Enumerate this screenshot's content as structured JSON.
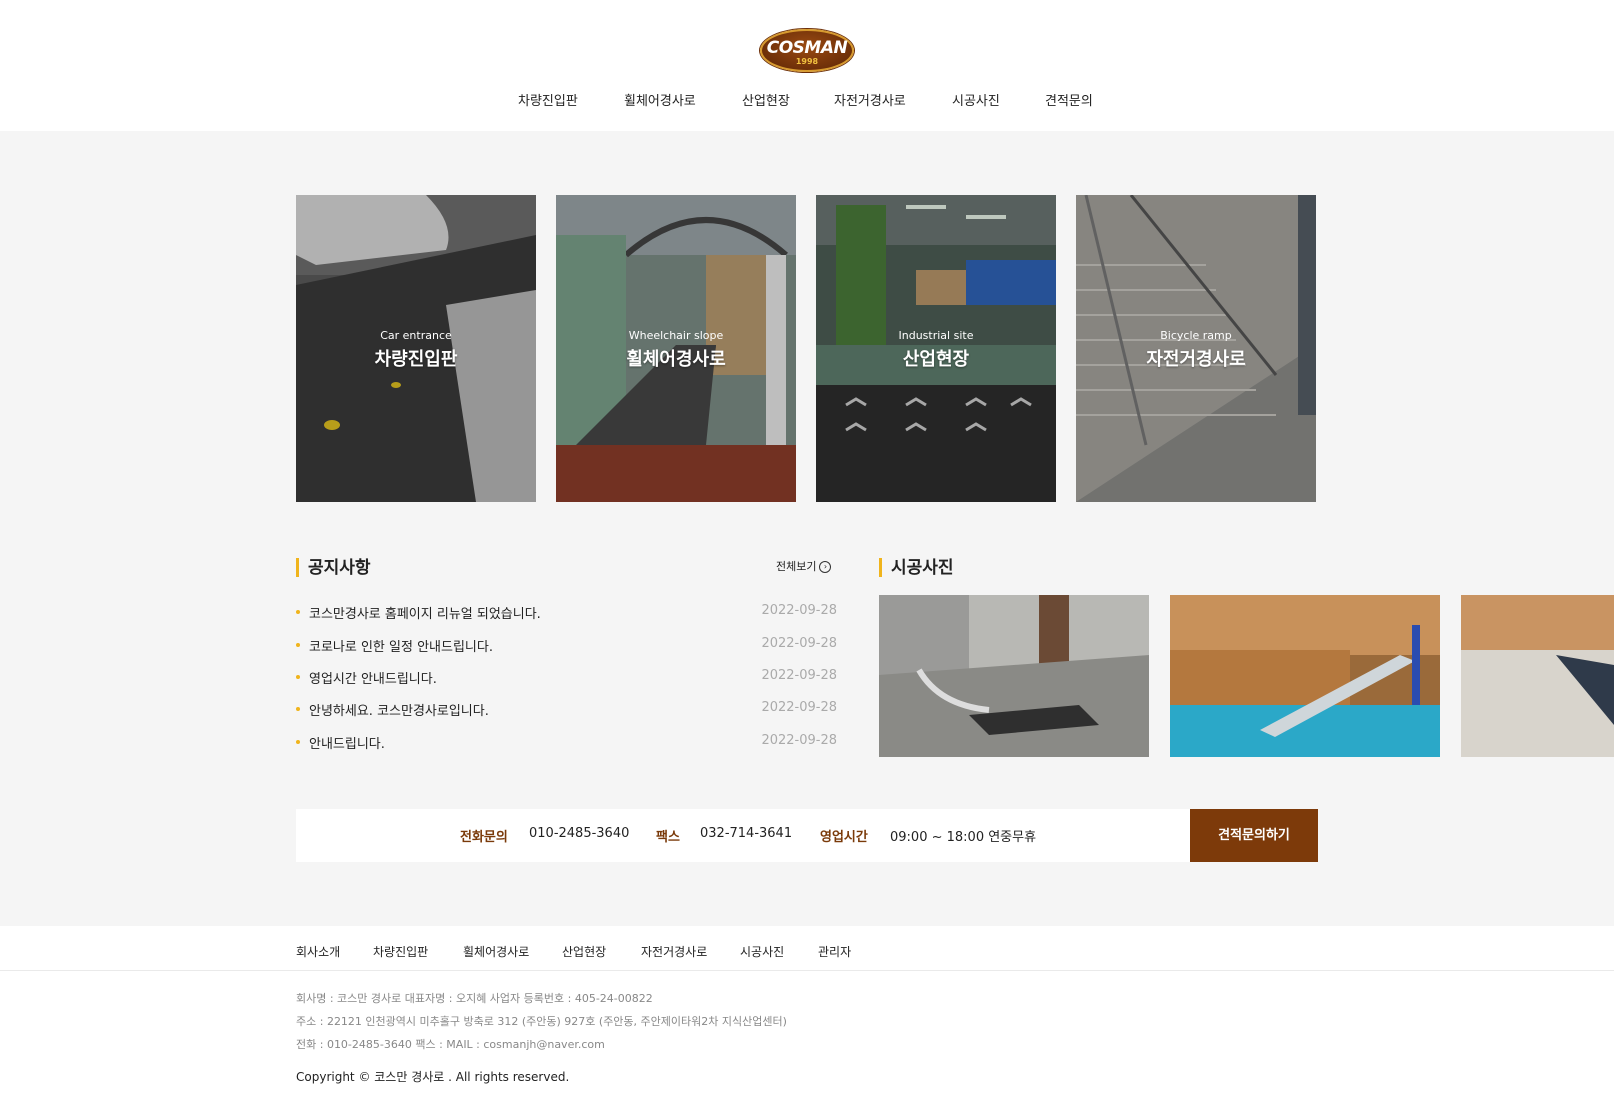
{
  "header": {
    "logo_text": "COSMAN",
    "logo_year": "1998",
    "nav": [
      "차량진입판",
      "휠체어경사로",
      "산업현장",
      "자전거경사로",
      "시공사진",
      "견적문의"
    ]
  },
  "cards": [
    {
      "en": "Car entrance",
      "ko": "차량진입판"
    },
    {
      "en": "Wheelchair slope",
      "ko": "휠체어경사로"
    },
    {
      "en": "Industrial site",
      "ko": "산업현장"
    },
    {
      "en": "Bicycle ramp",
      "ko": "자전거경사로"
    }
  ],
  "notice": {
    "title": "공지사항",
    "more_label": "전체보기",
    "items": [
      {
        "title": "코스만경사로 홈페이지 리뉴얼 되었습니다.",
        "date": "2022-09-28"
      },
      {
        "title": "코로나로 인한 일정 안내드립니다.",
        "date": "2022-09-28"
      },
      {
        "title": "영업시간 안내드립니다.",
        "date": "2022-09-28"
      },
      {
        "title": "안녕하세요. 코스만경사로입니다.",
        "date": "2022-09-28"
      },
      {
        "title": "안내드립니다.",
        "date": "2022-09-28"
      }
    ]
  },
  "gallery": {
    "title": "시공사진"
  },
  "contact": {
    "phone_label": "전화문의",
    "phone_value": "010-2485-3640",
    "fax_label": "팩스",
    "fax_value": "032-714-3641",
    "hours_label": "영업시간",
    "hours_value": "09:00 ~ 18:00 연중무휴",
    "button_label": "견적문의하기"
  },
  "footer": {
    "nav": [
      "회사소개",
      "차량진입판",
      "휠체어경사로",
      "산업현장",
      "자전거경사로",
      "시공사진",
      "관리자"
    ],
    "info_line1": "회사명 : 코스만 경사로    대표자명 : 오지혜     사업자 등록번호 : 405-24-00822",
    "info_line2": "주소 : 22121 인천광역시 미추홀구 방축로 312 (주안동) 927호 (주안동, 주안제이타워2차 지식산업센터)",
    "info_line3": "전화 : 010-2485-3640    팩스 :     MAIL : cosmanjh@naver.com",
    "copyright": "Copyright © 코스만 경사로 . All rights reserved."
  },
  "colors": {
    "accent_yellow": "#f0b41c",
    "brand_brown": "#7d3a0a",
    "background": "#f5f5f5"
  }
}
